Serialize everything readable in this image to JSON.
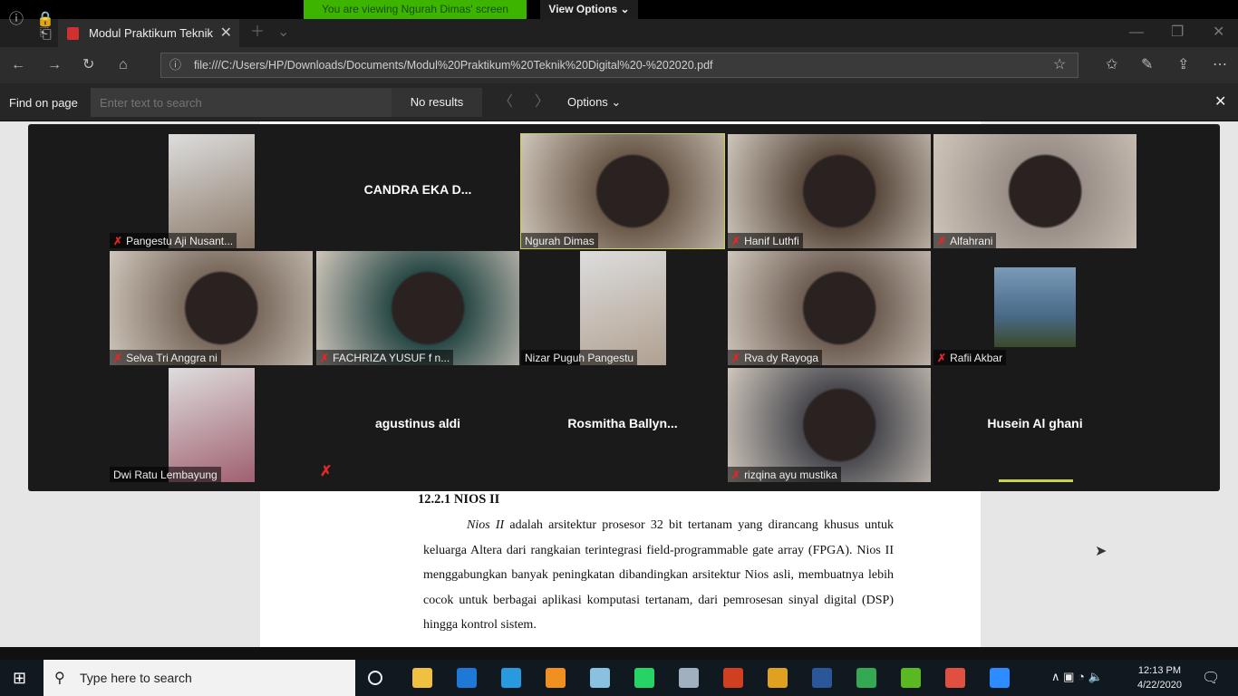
{
  "share_banner": {
    "viewing": "You are viewing Ngurah Dimas' screen",
    "view_options": "View Options ⌄"
  },
  "browser": {
    "tab_title": "Modul Praktikum Teknik",
    "url": "file:///C:/Users/HP/Downloads/Documents/Modul%20Praktikum%20Teknik%20Digital%20-%202020.pdf",
    "find": {
      "label": "Find on page",
      "placeholder": "Enter text to search",
      "results": "No results",
      "options": "Options ⌄"
    }
  },
  "participants": [
    {
      "name": "Pangestu Aji Nusant...",
      "kind": "video",
      "muted": true,
      "narrow": true,
      "color": "#8a7868"
    },
    {
      "name": "CANDRA EKA D...",
      "kind": "name",
      "muted": false
    },
    {
      "name": "Ngurah Dimas",
      "kind": "video",
      "muted": false,
      "active": true,
      "color": "#6b5a4a"
    },
    {
      "name": "Hanif Luthfi",
      "kind": "video",
      "muted": true,
      "color": "#5a4a3e"
    },
    {
      "name": "Alfahrani",
      "kind": "video",
      "muted": true,
      "color": "#9a8f88"
    },
    {
      "name": "Selva Tri Anggra ni",
      "kind": "video",
      "muted": true,
      "color": "#7a6a5e"
    },
    {
      "name": "FACHRIZA YUSUF f n...",
      "kind": "video",
      "muted": true,
      "color": "#2a4a48"
    },
    {
      "name": "Nizar Puguh Pangestu",
      "kind": "video",
      "muted": false,
      "narrow": true,
      "color": "#b0a090"
    },
    {
      "name": "Rva dy Rayoga",
      "kind": "video",
      "muted": true,
      "color": "#6e5e54"
    },
    {
      "name": "Rafii Akbar",
      "kind": "photo",
      "muted": true,
      "color": "#4a6a8a"
    },
    {
      "name": "Dwi Ratu Lembayung",
      "kind": "video",
      "muted": false,
      "narrow": true,
      "color": "#a06070"
    },
    {
      "name": "agustinus aldi",
      "kind": "name",
      "muted": true
    },
    {
      "name": "Rosmitha  Ballyn...",
      "kind": "name",
      "muted": false
    },
    {
      "name": "rizqina ayu mustika",
      "kind": "video",
      "muted": true,
      "color": "#4a4a50"
    },
    {
      "name": "Husein Al ghani",
      "kind": "name",
      "muted": false,
      "speaking": true
    }
  ],
  "document": {
    "heading": "12.2.1 NIOS II",
    "italic": "Nios II",
    "body": " adalah arsitektur prosesor 32 bit tertanam yang dirancang khusus untuk keluarga Altera dari rangkaian terintegrasi field-programmable gate array (FPGA). Nios II menggabungkan banyak peningkatan dibandingkan arsitektur Nios asli, membuatnya lebih cocok untuk berbagai aplikasi komputasi tertanam, dari pemrosesan sinyal digital (DSP) hingga kontrol sistem."
  },
  "taskbar": {
    "search_placeholder": "Type here to search",
    "time": "12:13 PM",
    "date": "4/22/2020",
    "apps": [
      {
        "name": "task-view",
        "color": "#101820"
      },
      {
        "name": "file-explorer",
        "color": "#f0c040"
      },
      {
        "name": "edge",
        "color": "#1e78d6"
      },
      {
        "name": "internet-explorer",
        "color": "#2a9ae0"
      },
      {
        "name": "sublime-text",
        "color": "#f09020"
      },
      {
        "name": "notes",
        "color": "#8ac0e0"
      },
      {
        "name": "whatsapp",
        "color": "#25d366"
      },
      {
        "name": "app",
        "color": "#a0b0c0"
      },
      {
        "name": "powerpoint",
        "color": "#d04020"
      },
      {
        "name": "chrome",
        "color": "#e0a020"
      },
      {
        "name": "word",
        "color": "#2b579a"
      },
      {
        "name": "chrome-profile",
        "color": "#34a853"
      },
      {
        "name": "camtasia-green",
        "color": "#5ab820"
      },
      {
        "name": "camtasia-red",
        "color": "#e05040"
      },
      {
        "name": "zoom",
        "color": "#2d8cff"
      }
    ]
  }
}
